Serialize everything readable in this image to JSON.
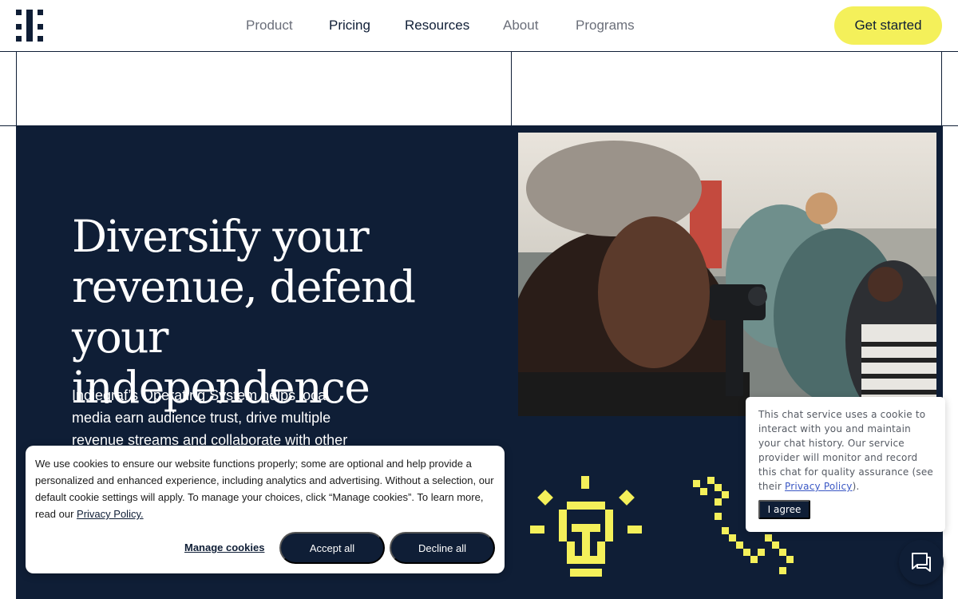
{
  "header": {
    "logo_icon": "indiegraf-logo-icon",
    "nav": [
      {
        "label": "Product"
      },
      {
        "label": "Pricing"
      },
      {
        "label": "Resources"
      },
      {
        "label": "About"
      },
      {
        "label": "Programs"
      }
    ],
    "cta_label": "Get started"
  },
  "hero": {
    "title": "Diversify your revenue, defend your independence",
    "description": "Indiegraf’s Operating System helps local media earn audience trust, drive multiple revenue streams and collaborate with other",
    "icons": [
      "lightbulb-icon",
      "phone-icon"
    ]
  },
  "cookie_banner": {
    "text": "We use cookies to ensure our website functions properly; some are optional and help provide a personalized and enhanced experience, including analytics and advertising. Without a selection, our default cookie settings will apply. To manage your choices, click “Manage cookies”. To learn more, read our ",
    "privacy_link": "Privacy Policy.",
    "manage_label": "Manage cookies",
    "accept_label": "Accept all",
    "decline_label": "Decline all"
  },
  "chat_notice": {
    "text": "This chat service uses a cookie to interact with you and maintain your chat history. Our service provider will monitor and record this chat for quality assurance (see their ",
    "privacy_link": "Privacy Policy",
    "text_end": ").",
    "agree_label": "I agree",
    "launcher_icon": "chat-bubble-icon"
  },
  "colors": {
    "navy": "#0f1e36",
    "yellow": "#f4f05a",
    "white": "#ffffff"
  }
}
